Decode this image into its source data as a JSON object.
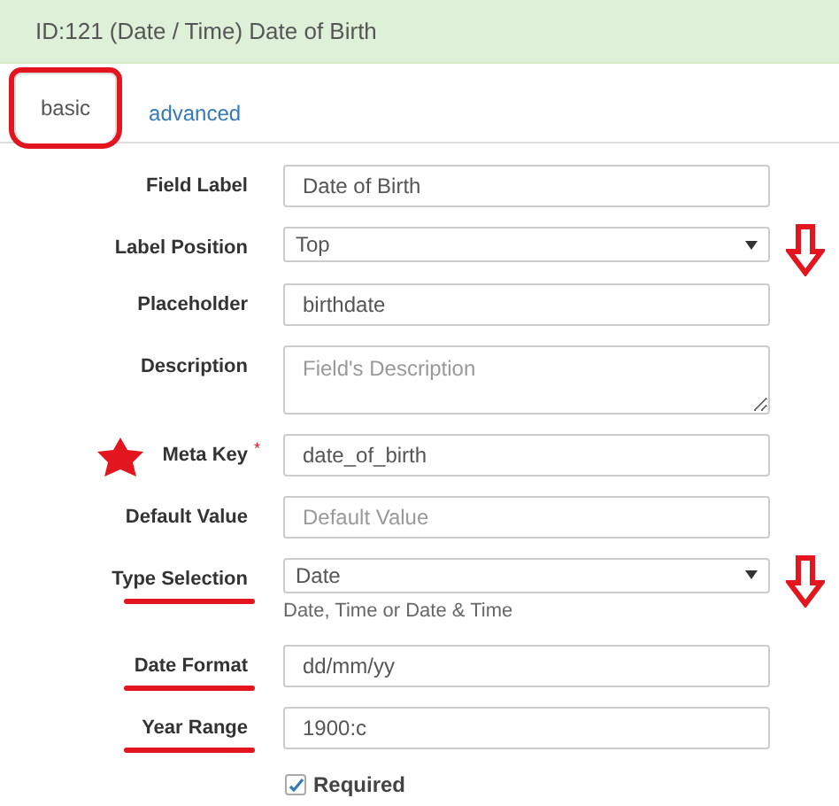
{
  "header": {
    "title": "ID:121 (Date / Time) Date of Birth"
  },
  "tabs": [
    {
      "label": "basic",
      "selected": true,
      "circled": true
    },
    {
      "label": "advanced",
      "selected": false,
      "circled": false
    }
  ],
  "fields": [
    {
      "kind": "input",
      "label": "Field Label",
      "value": "Date of Birth"
    },
    {
      "kind": "select",
      "label": "Label Position",
      "value": "Top",
      "arrow": true
    },
    {
      "kind": "input",
      "label": "Placeholder",
      "value": "birthdate"
    },
    {
      "kind": "textarea",
      "label": "Description",
      "placeholder": "Field's Description"
    },
    {
      "kind": "input",
      "label": "Meta Key",
      "value": "date_of_birth",
      "required_mark": "*",
      "star": true
    },
    {
      "kind": "input",
      "label": "Default Value",
      "placeholder": "Default Value"
    },
    {
      "kind": "select",
      "label": "Type Selection",
      "value": "Date",
      "help": "Date, Time or Date & Time",
      "arrow": true,
      "underline": true
    },
    {
      "kind": "input",
      "label": "Date Format",
      "value": "dd/mm/yy",
      "underline": true
    },
    {
      "kind": "input",
      "label": "Year Range",
      "value": "1900:c",
      "underline": true
    },
    {
      "kind": "checkbox",
      "label": "Required",
      "checked": true
    }
  ]
}
